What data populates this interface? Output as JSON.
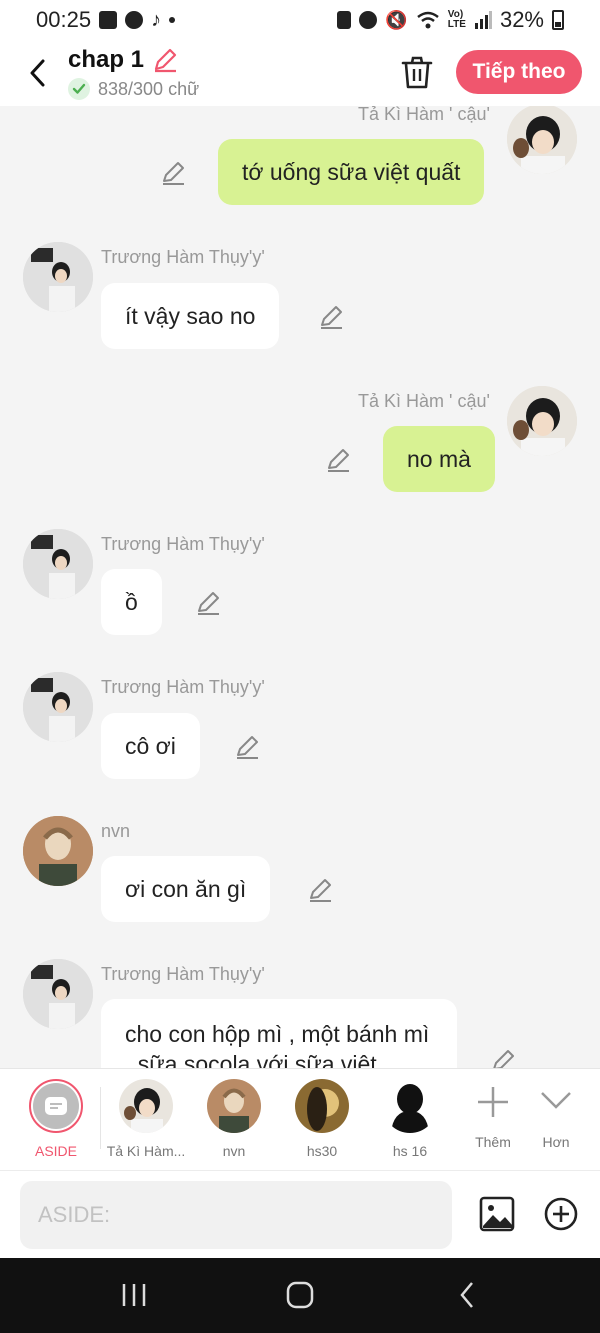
{
  "status_bar": {
    "time": "00:25",
    "battery": "32%"
  },
  "header": {
    "title": "chap 1",
    "word_count": "838/300 chữ",
    "next_label": "Tiếp theo"
  },
  "messages": [
    {
      "side": "right",
      "name": "Tả Kì Hàm ' cậu'",
      "text": "tớ uống sữa việt quất"
    },
    {
      "side": "left",
      "name": "Trương Hàm Thụy'y'",
      "text": "ít vậy sao no"
    },
    {
      "side": "right",
      "name": "Tả Kì Hàm ' cậu'",
      "text": "no mà"
    },
    {
      "side": "left",
      "name": "Trương Hàm Thụy'y'",
      "text": "ồ"
    },
    {
      "side": "left",
      "name": "Trương Hàm Thụy'y'",
      "text": "cô ơi"
    },
    {
      "side": "left",
      "name": "nvn",
      "text": "ơi con ăn gì"
    },
    {
      "side": "left",
      "name": "Trương Hàm Thụy'y'",
      "text": "cho con hộp mì , một bánh mì , sữa socola với sữa việt"
    }
  ],
  "characters": [
    {
      "label": "ASIDE"
    },
    {
      "label": "Tả Kì Hàm..."
    },
    {
      "label": "nvn"
    },
    {
      "label": "hs30"
    },
    {
      "label": "hs 16"
    },
    {
      "label": "Thêm"
    },
    {
      "label": "Hơn"
    }
  ],
  "input": {
    "placeholder": "ASIDE:",
    "value": ""
  },
  "colors": {
    "accent": "#f0566e",
    "bubble_right": "#d8f293",
    "bubble_left": "#ffffff",
    "background": "#f4f4f4"
  }
}
